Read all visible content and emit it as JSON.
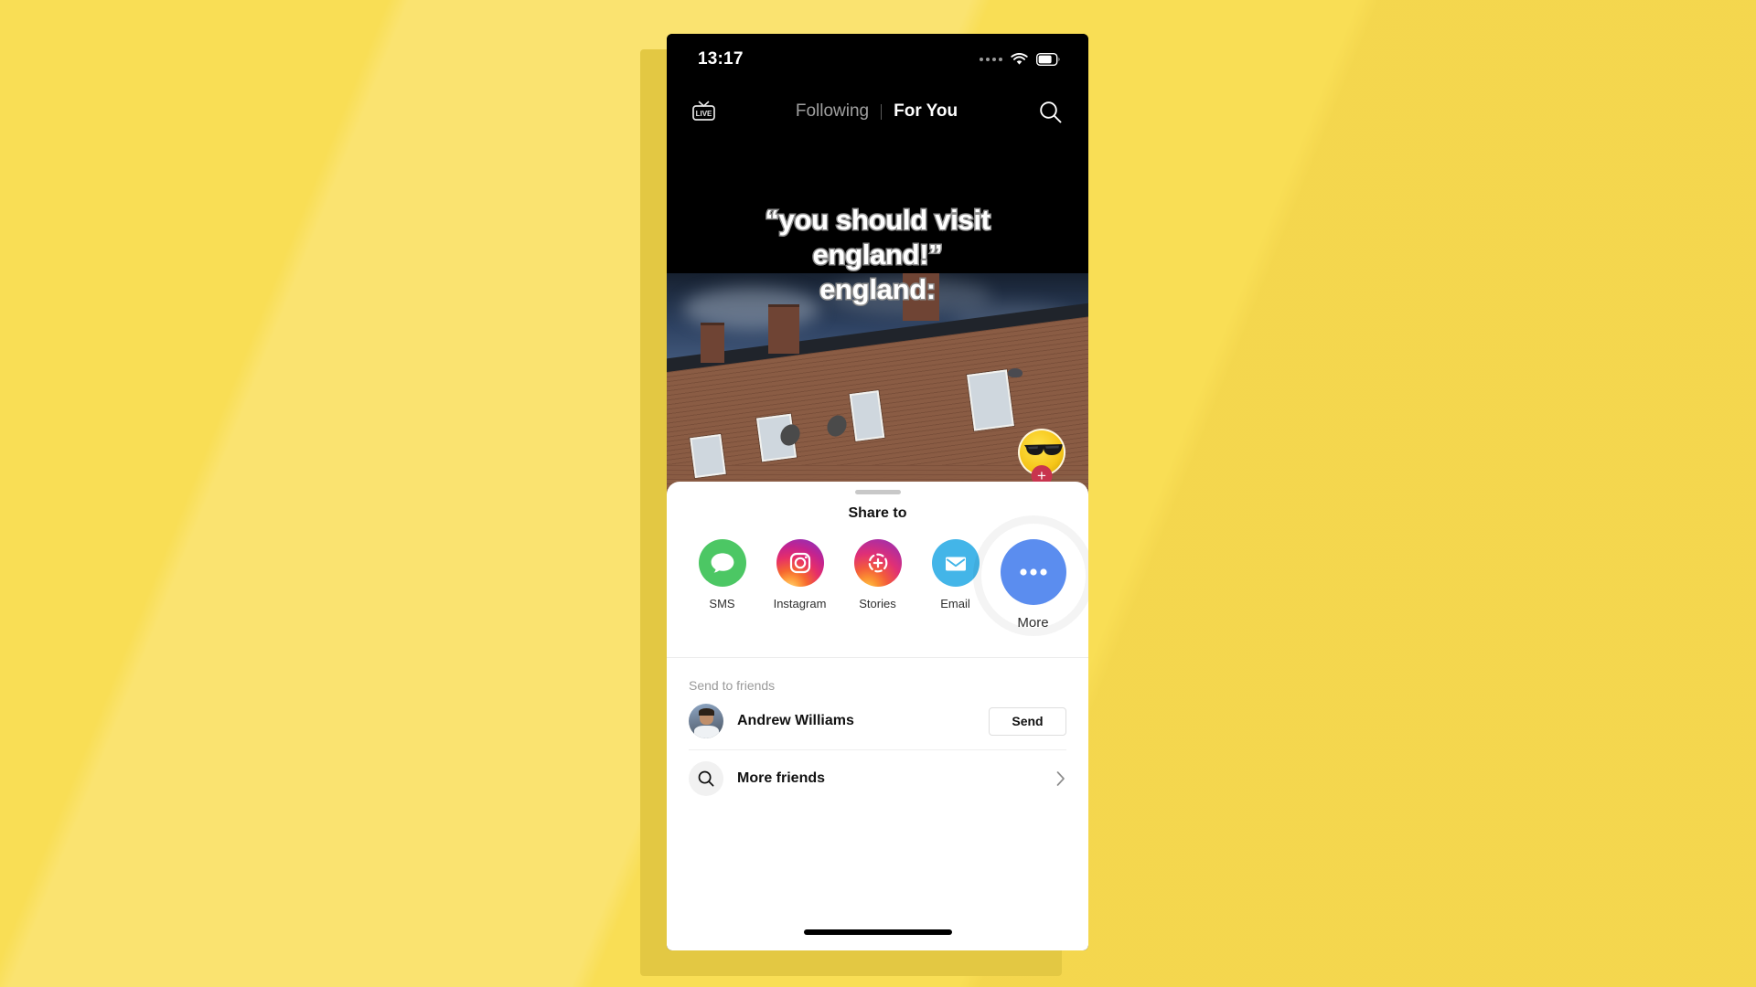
{
  "theme": {
    "page_background": "#F9DE55",
    "shadow_color": "#E3C843",
    "accent_blue": "#5B8DEF",
    "sms_green": "#4CC764",
    "email_blue": "#43B5E8",
    "follow_red": "#C8344E",
    "sheet_background": "#FFFFFF",
    "video_background": "#000000"
  },
  "status_bar": {
    "time": "13:17",
    "signal_icon": "signal-dots-icon",
    "wifi_icon": "wifi-icon",
    "battery_icon": "battery-icon"
  },
  "top_nav": {
    "live_icon": "live-tv-icon",
    "live_label": "LIVE",
    "tab_following": "Following",
    "tab_for_you": "For You",
    "active_tab": "For You",
    "search_icon": "search-icon"
  },
  "video": {
    "caption_line_1": "“you should visit",
    "caption_line_2": "england!”",
    "caption_line_3": "england:",
    "avatar_icon": "sunglasses-smiley-avatar",
    "follow_label": "+"
  },
  "share_sheet": {
    "drag_handle": "drag-handle",
    "title": "Share to",
    "targets": [
      {
        "label": "SMS",
        "icon": "sms-bubble-icon"
      },
      {
        "label": "Instagram",
        "icon": "instagram-camera-icon"
      },
      {
        "label": "Stories",
        "icon": "instagram-stories-plus-icon"
      },
      {
        "label": "Email",
        "icon": "email-envelope-icon"
      },
      {
        "label": "More",
        "icon": "more-ellipsis-icon",
        "highlighted": true
      }
    ],
    "friends_title": "Send to friends",
    "friends": [
      {
        "name": "Andrew Williams",
        "avatar": "photo-avatar",
        "action_label": "Send"
      }
    ],
    "more_friends": {
      "label": "More friends",
      "icon": "search-icon",
      "chevron": "chevron-right-icon"
    }
  },
  "home_indicator": "home-indicator-bar"
}
